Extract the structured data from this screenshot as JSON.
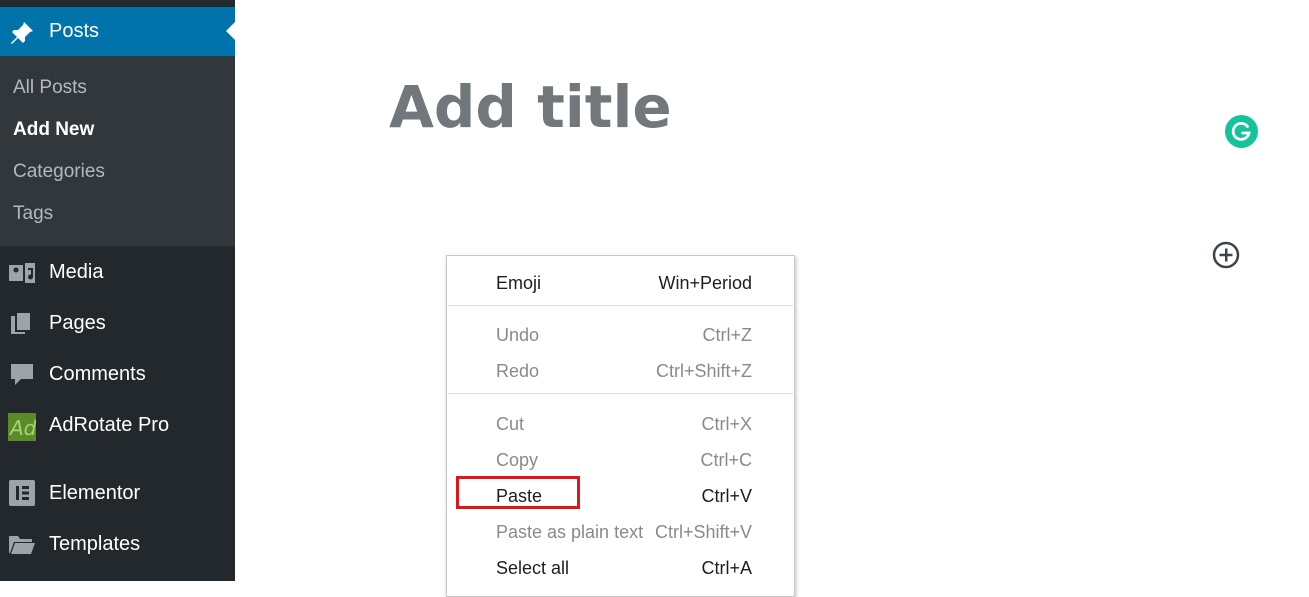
{
  "sidebar": {
    "posts_label": "Posts",
    "submenu": [
      {
        "label": "All Posts",
        "current": false
      },
      {
        "label": "Add New",
        "current": true
      },
      {
        "label": "Categories",
        "current": false
      },
      {
        "label": "Tags",
        "current": false
      }
    ],
    "menu": [
      {
        "label": "Media",
        "icon": "media-icon"
      },
      {
        "label": "Pages",
        "icon": "pages-icon"
      },
      {
        "label": "Comments",
        "icon": "comments-icon"
      },
      {
        "label": "AdRotate Pro",
        "icon": "adrotate-icon"
      },
      {
        "label": "Elementor",
        "icon": "elementor-icon"
      },
      {
        "label": "Templates",
        "icon": "templates-icon"
      }
    ]
  },
  "editor": {
    "title_placeholder": "Add title"
  },
  "context_menu": {
    "items": [
      {
        "label": "Emoji",
        "shortcut": "Win+Period",
        "enabled": true
      },
      {
        "label": "Undo",
        "shortcut": "Ctrl+Z",
        "enabled": false
      },
      {
        "label": "Redo",
        "shortcut": "Ctrl+Shift+Z",
        "enabled": false
      },
      {
        "label": "Cut",
        "shortcut": "Ctrl+X",
        "enabled": false
      },
      {
        "label": "Copy",
        "shortcut": "Ctrl+C",
        "enabled": false
      },
      {
        "label": "Paste",
        "shortcut": "Ctrl+V",
        "enabled": true
      },
      {
        "label": "Paste as plain text",
        "shortcut": "Ctrl+Shift+V",
        "enabled": false
      },
      {
        "label": "Select all",
        "shortcut": "Ctrl+A",
        "enabled": true
      }
    ]
  },
  "colors": {
    "sidebar_bg": "#23282d",
    "submenu_bg": "#32373c",
    "active_bg": "#0073aa",
    "highlight": "#e3151b",
    "grammarly": "#15c39a"
  }
}
